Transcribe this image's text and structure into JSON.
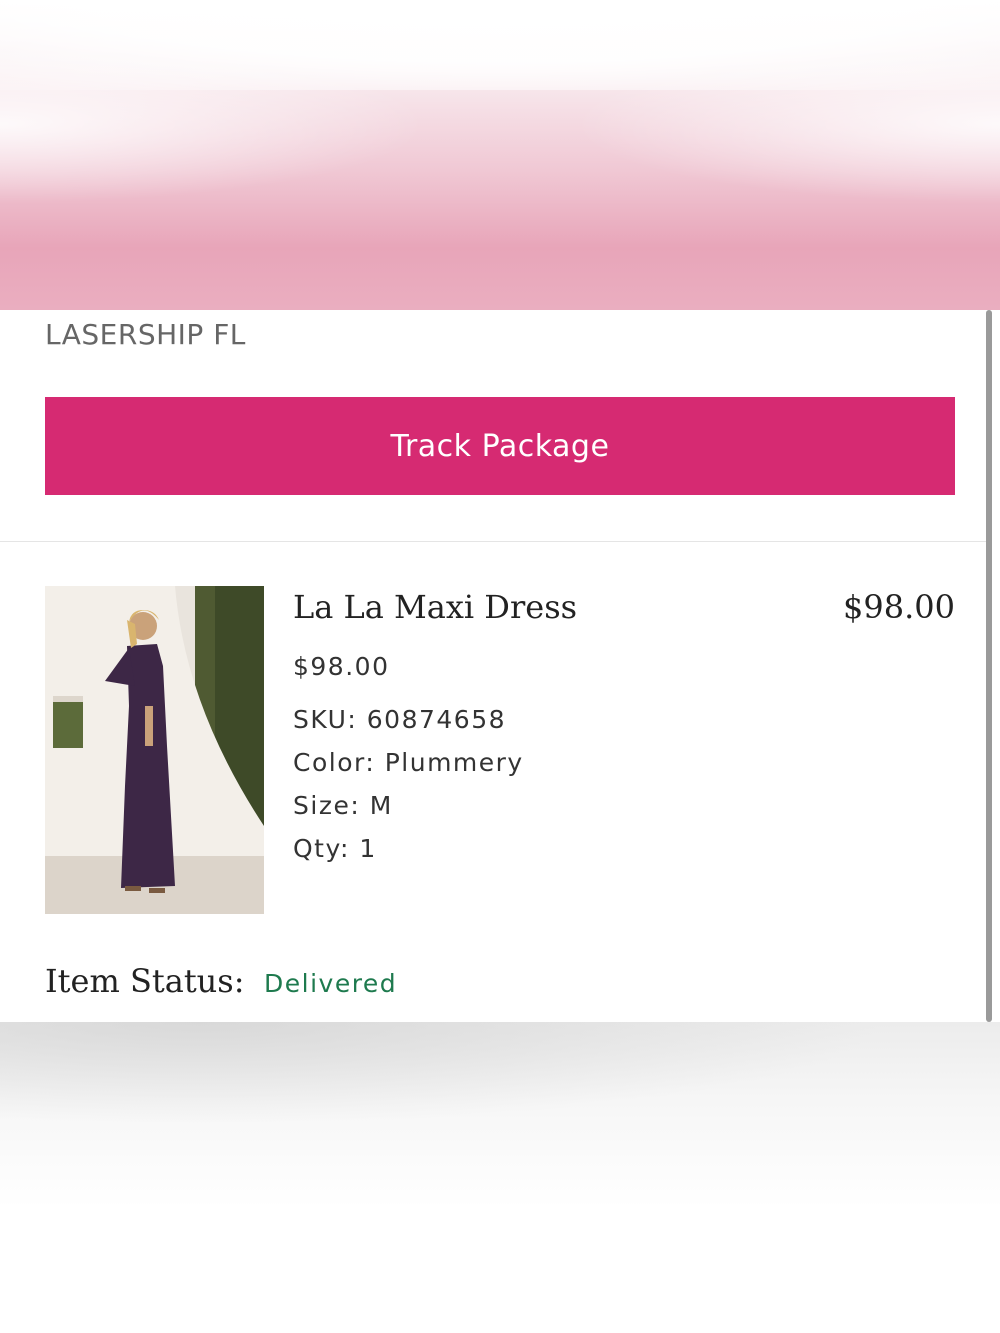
{
  "shipment": {
    "carrier": "LASERSHIP FL",
    "track_button_label": "Track Package"
  },
  "item": {
    "image_icon": "product-photo",
    "name": "La La Maxi Dress",
    "line_total": "$98.00",
    "unit_price": "$98.00",
    "sku": "SKU: 60874658",
    "color": "Color: Plummery",
    "size": "Size: M",
    "qty": "Qty: 1",
    "status_label": "Item Status:",
    "status_value": "Delivered"
  },
  "colors": {
    "accent": "#d62a72",
    "status_delivered": "#1e7a4e"
  }
}
